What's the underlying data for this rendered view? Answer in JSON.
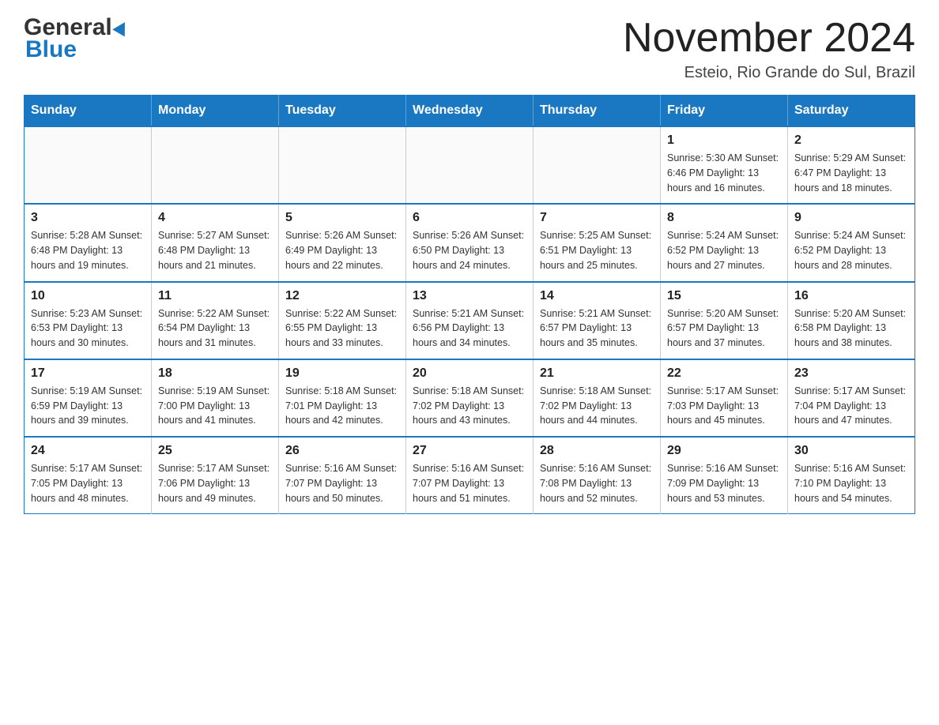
{
  "header": {
    "logo_line1": "General",
    "logo_line2": "Blue",
    "title": "November 2024",
    "subtitle": "Esteio, Rio Grande do Sul, Brazil"
  },
  "calendar": {
    "days_of_week": [
      "Sunday",
      "Monday",
      "Tuesday",
      "Wednesday",
      "Thursday",
      "Friday",
      "Saturday"
    ],
    "weeks": [
      [
        {
          "day": "",
          "info": ""
        },
        {
          "day": "",
          "info": ""
        },
        {
          "day": "",
          "info": ""
        },
        {
          "day": "",
          "info": ""
        },
        {
          "day": "",
          "info": ""
        },
        {
          "day": "1",
          "info": "Sunrise: 5:30 AM\nSunset: 6:46 PM\nDaylight: 13 hours and 16 minutes."
        },
        {
          "day": "2",
          "info": "Sunrise: 5:29 AM\nSunset: 6:47 PM\nDaylight: 13 hours and 18 minutes."
        }
      ],
      [
        {
          "day": "3",
          "info": "Sunrise: 5:28 AM\nSunset: 6:48 PM\nDaylight: 13 hours and 19 minutes."
        },
        {
          "day": "4",
          "info": "Sunrise: 5:27 AM\nSunset: 6:48 PM\nDaylight: 13 hours and 21 minutes."
        },
        {
          "day": "5",
          "info": "Sunrise: 5:26 AM\nSunset: 6:49 PM\nDaylight: 13 hours and 22 minutes."
        },
        {
          "day": "6",
          "info": "Sunrise: 5:26 AM\nSunset: 6:50 PM\nDaylight: 13 hours and 24 minutes."
        },
        {
          "day": "7",
          "info": "Sunrise: 5:25 AM\nSunset: 6:51 PM\nDaylight: 13 hours and 25 minutes."
        },
        {
          "day": "8",
          "info": "Sunrise: 5:24 AM\nSunset: 6:52 PM\nDaylight: 13 hours and 27 minutes."
        },
        {
          "day": "9",
          "info": "Sunrise: 5:24 AM\nSunset: 6:52 PM\nDaylight: 13 hours and 28 minutes."
        }
      ],
      [
        {
          "day": "10",
          "info": "Sunrise: 5:23 AM\nSunset: 6:53 PM\nDaylight: 13 hours and 30 minutes."
        },
        {
          "day": "11",
          "info": "Sunrise: 5:22 AM\nSunset: 6:54 PM\nDaylight: 13 hours and 31 minutes."
        },
        {
          "day": "12",
          "info": "Sunrise: 5:22 AM\nSunset: 6:55 PM\nDaylight: 13 hours and 33 minutes."
        },
        {
          "day": "13",
          "info": "Sunrise: 5:21 AM\nSunset: 6:56 PM\nDaylight: 13 hours and 34 minutes."
        },
        {
          "day": "14",
          "info": "Sunrise: 5:21 AM\nSunset: 6:57 PM\nDaylight: 13 hours and 35 minutes."
        },
        {
          "day": "15",
          "info": "Sunrise: 5:20 AM\nSunset: 6:57 PM\nDaylight: 13 hours and 37 minutes."
        },
        {
          "day": "16",
          "info": "Sunrise: 5:20 AM\nSunset: 6:58 PM\nDaylight: 13 hours and 38 minutes."
        }
      ],
      [
        {
          "day": "17",
          "info": "Sunrise: 5:19 AM\nSunset: 6:59 PM\nDaylight: 13 hours and 39 minutes."
        },
        {
          "day": "18",
          "info": "Sunrise: 5:19 AM\nSunset: 7:00 PM\nDaylight: 13 hours and 41 minutes."
        },
        {
          "day": "19",
          "info": "Sunrise: 5:18 AM\nSunset: 7:01 PM\nDaylight: 13 hours and 42 minutes."
        },
        {
          "day": "20",
          "info": "Sunrise: 5:18 AM\nSunset: 7:02 PM\nDaylight: 13 hours and 43 minutes."
        },
        {
          "day": "21",
          "info": "Sunrise: 5:18 AM\nSunset: 7:02 PM\nDaylight: 13 hours and 44 minutes."
        },
        {
          "day": "22",
          "info": "Sunrise: 5:17 AM\nSunset: 7:03 PM\nDaylight: 13 hours and 45 minutes."
        },
        {
          "day": "23",
          "info": "Sunrise: 5:17 AM\nSunset: 7:04 PM\nDaylight: 13 hours and 47 minutes."
        }
      ],
      [
        {
          "day": "24",
          "info": "Sunrise: 5:17 AM\nSunset: 7:05 PM\nDaylight: 13 hours and 48 minutes."
        },
        {
          "day": "25",
          "info": "Sunrise: 5:17 AM\nSunset: 7:06 PM\nDaylight: 13 hours and 49 minutes."
        },
        {
          "day": "26",
          "info": "Sunrise: 5:16 AM\nSunset: 7:07 PM\nDaylight: 13 hours and 50 minutes."
        },
        {
          "day": "27",
          "info": "Sunrise: 5:16 AM\nSunset: 7:07 PM\nDaylight: 13 hours and 51 minutes."
        },
        {
          "day": "28",
          "info": "Sunrise: 5:16 AM\nSunset: 7:08 PM\nDaylight: 13 hours and 52 minutes."
        },
        {
          "day": "29",
          "info": "Sunrise: 5:16 AM\nSunset: 7:09 PM\nDaylight: 13 hours and 53 minutes."
        },
        {
          "day": "30",
          "info": "Sunrise: 5:16 AM\nSunset: 7:10 PM\nDaylight: 13 hours and 54 minutes."
        }
      ]
    ]
  }
}
